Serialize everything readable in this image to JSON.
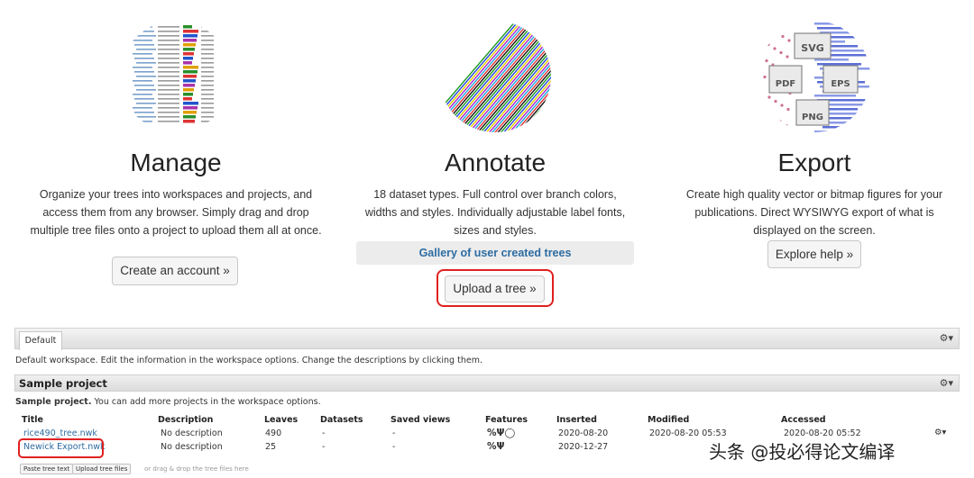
{
  "features": {
    "manage": {
      "title": "Manage",
      "description": "Organize your trees into workspaces and projects, and access them from any browser. Simply drag and drop multiple tree files onto a project to upload them all at once.",
      "button": "Create an account »"
    },
    "annotate": {
      "title": "Annotate",
      "description": "18 dataset types. Full control over branch colors, widths and styles. Individually adjustable label fonts, sizes and styles.",
      "gallery_link": "Gallery of user created trees",
      "button": "Upload a tree »"
    },
    "export": {
      "title": "Export",
      "description": "Create high quality vector or bitmap figures for your publications. Direct WYSIWYG export of what is displayed on the screen.",
      "button": "Explore help »",
      "formats": [
        "SVG",
        "PDF",
        "EPS",
        "PNG"
      ]
    }
  },
  "workspace": {
    "tab": "Default",
    "description": "Default workspace. Edit the information in the workspace options. Change the descriptions by clicking them.",
    "gear": "⚙▾"
  },
  "project": {
    "title": "Sample project",
    "description_bold": "Sample project.",
    "description_rest": " You can add more projects in the workspace options.",
    "gear": "⚙▾",
    "columns": [
      "Title",
      "Description",
      "Leaves",
      "Datasets",
      "Saved views",
      "Features",
      "Inserted",
      "Modified",
      "Accessed"
    ],
    "rows": [
      {
        "title": "rice490_tree.nwk",
        "description": "No description",
        "leaves": "490",
        "datasets": "-",
        "saved_views": "-",
        "features": "%Ψ◯",
        "inserted": "2020-08-20",
        "modified": "2020-08-20 05:53",
        "accessed": "2020-08-20 05:52",
        "gear": "⚙▾"
      },
      {
        "title": "Newick Export.nwk",
        "description": "No description",
        "leaves": "25",
        "datasets": "-",
        "saved_views": "-",
        "features": "%Ψ",
        "inserted": "2020-12-27",
        "modified": "",
        "accessed": "",
        "gear": ""
      }
    ],
    "paste_button": "Paste tree text",
    "upload_button": "Upload tree files",
    "drop_hint": "or drag & drop the tree files here"
  },
  "watermark": "头条 @投必得论文编译",
  "colors": {
    "highlight": "#e02020",
    "link": "#2d6ca2"
  }
}
